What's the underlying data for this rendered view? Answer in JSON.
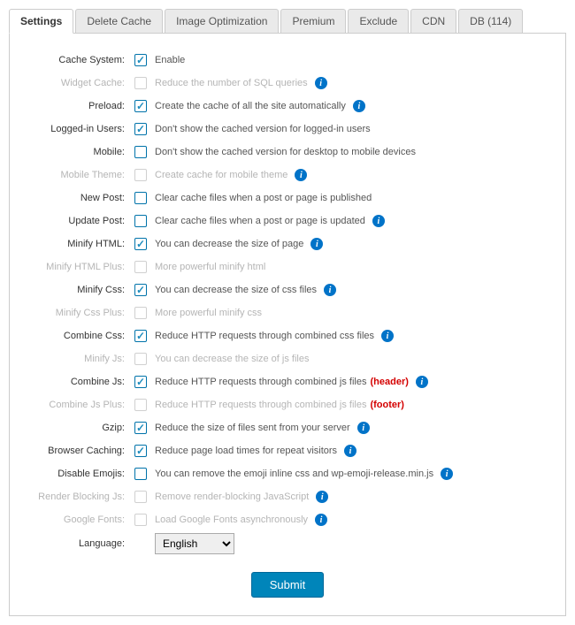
{
  "tabs": [
    "Settings",
    "Delete Cache",
    "Image Optimization",
    "Premium",
    "Exclude",
    "CDN",
    "DB (114)"
  ],
  "activeTab": 0,
  "rows": [
    {
      "label": "Cache System:",
      "desc": "Enable",
      "checked": true,
      "disabled": false,
      "info": false
    },
    {
      "label": "Widget Cache:",
      "desc": "Reduce the number of SQL queries",
      "checked": false,
      "disabled": true,
      "info": true
    },
    {
      "label": "Preload:",
      "desc": "Create the cache of all the site automatically",
      "checked": true,
      "disabled": false,
      "info": true
    },
    {
      "label": "Logged-in Users:",
      "desc": "Don't show the cached version for logged-in users",
      "checked": true,
      "disabled": false,
      "info": false
    },
    {
      "label": "Mobile:",
      "desc": "Don't show the cached version for desktop to mobile devices",
      "checked": false,
      "disabled": false,
      "info": false
    },
    {
      "label": "Mobile Theme:",
      "desc": "Create cache for mobile theme",
      "checked": false,
      "disabled": true,
      "info": true
    },
    {
      "label": "New Post:",
      "desc": "Clear cache files when a post or page is published",
      "checked": false,
      "disabled": false,
      "info": false
    },
    {
      "label": "Update Post:",
      "desc": "Clear cache files when a post or page is updated",
      "checked": false,
      "disabled": false,
      "info": true
    },
    {
      "label": "Minify HTML:",
      "desc": "You can decrease the size of page",
      "checked": true,
      "disabled": false,
      "info": true
    },
    {
      "label": "Minify HTML Plus:",
      "desc": "More powerful minify html",
      "checked": false,
      "disabled": true,
      "info": false
    },
    {
      "label": "Minify Css:",
      "desc": "You can decrease the size of css files",
      "checked": true,
      "disabled": false,
      "info": true
    },
    {
      "label": "Minify Css Plus:",
      "desc": "More powerful minify css",
      "checked": false,
      "disabled": true,
      "info": false
    },
    {
      "label": "Combine Css:",
      "desc": "Reduce HTTP requests through combined css files",
      "checked": true,
      "disabled": false,
      "info": true
    },
    {
      "label": "Minify Js:",
      "desc": "You can decrease the size of js files",
      "checked": false,
      "disabled": true,
      "info": false
    },
    {
      "label": "Combine Js:",
      "desc": "Reduce HTTP requests through combined js files",
      "checked": true,
      "disabled": false,
      "info": true,
      "suffix": "(header)"
    },
    {
      "label": "Combine Js Plus:",
      "desc": "Reduce HTTP requests through combined js files",
      "checked": false,
      "disabled": true,
      "info": false,
      "suffix": "(footer)"
    },
    {
      "label": "Gzip:",
      "desc": "Reduce the size of files sent from your server",
      "checked": true,
      "disabled": false,
      "info": true
    },
    {
      "label": "Browser Caching:",
      "desc": "Reduce page load times for repeat visitors",
      "checked": true,
      "disabled": false,
      "info": true
    },
    {
      "label": "Disable Emojis:",
      "desc": "You can remove the emoji inline css and wp-emoji-release.min.js",
      "checked": false,
      "disabled": false,
      "info": true
    },
    {
      "label": "Render Blocking Js:",
      "desc": "Remove render-blocking JavaScript",
      "checked": false,
      "disabled": true,
      "info": true
    },
    {
      "label": "Google Fonts:",
      "desc": "Load Google Fonts asynchronously",
      "checked": false,
      "disabled": true,
      "info": true
    }
  ],
  "languageLabel": "Language:",
  "languageValue": "English",
  "submitLabel": "Submit"
}
